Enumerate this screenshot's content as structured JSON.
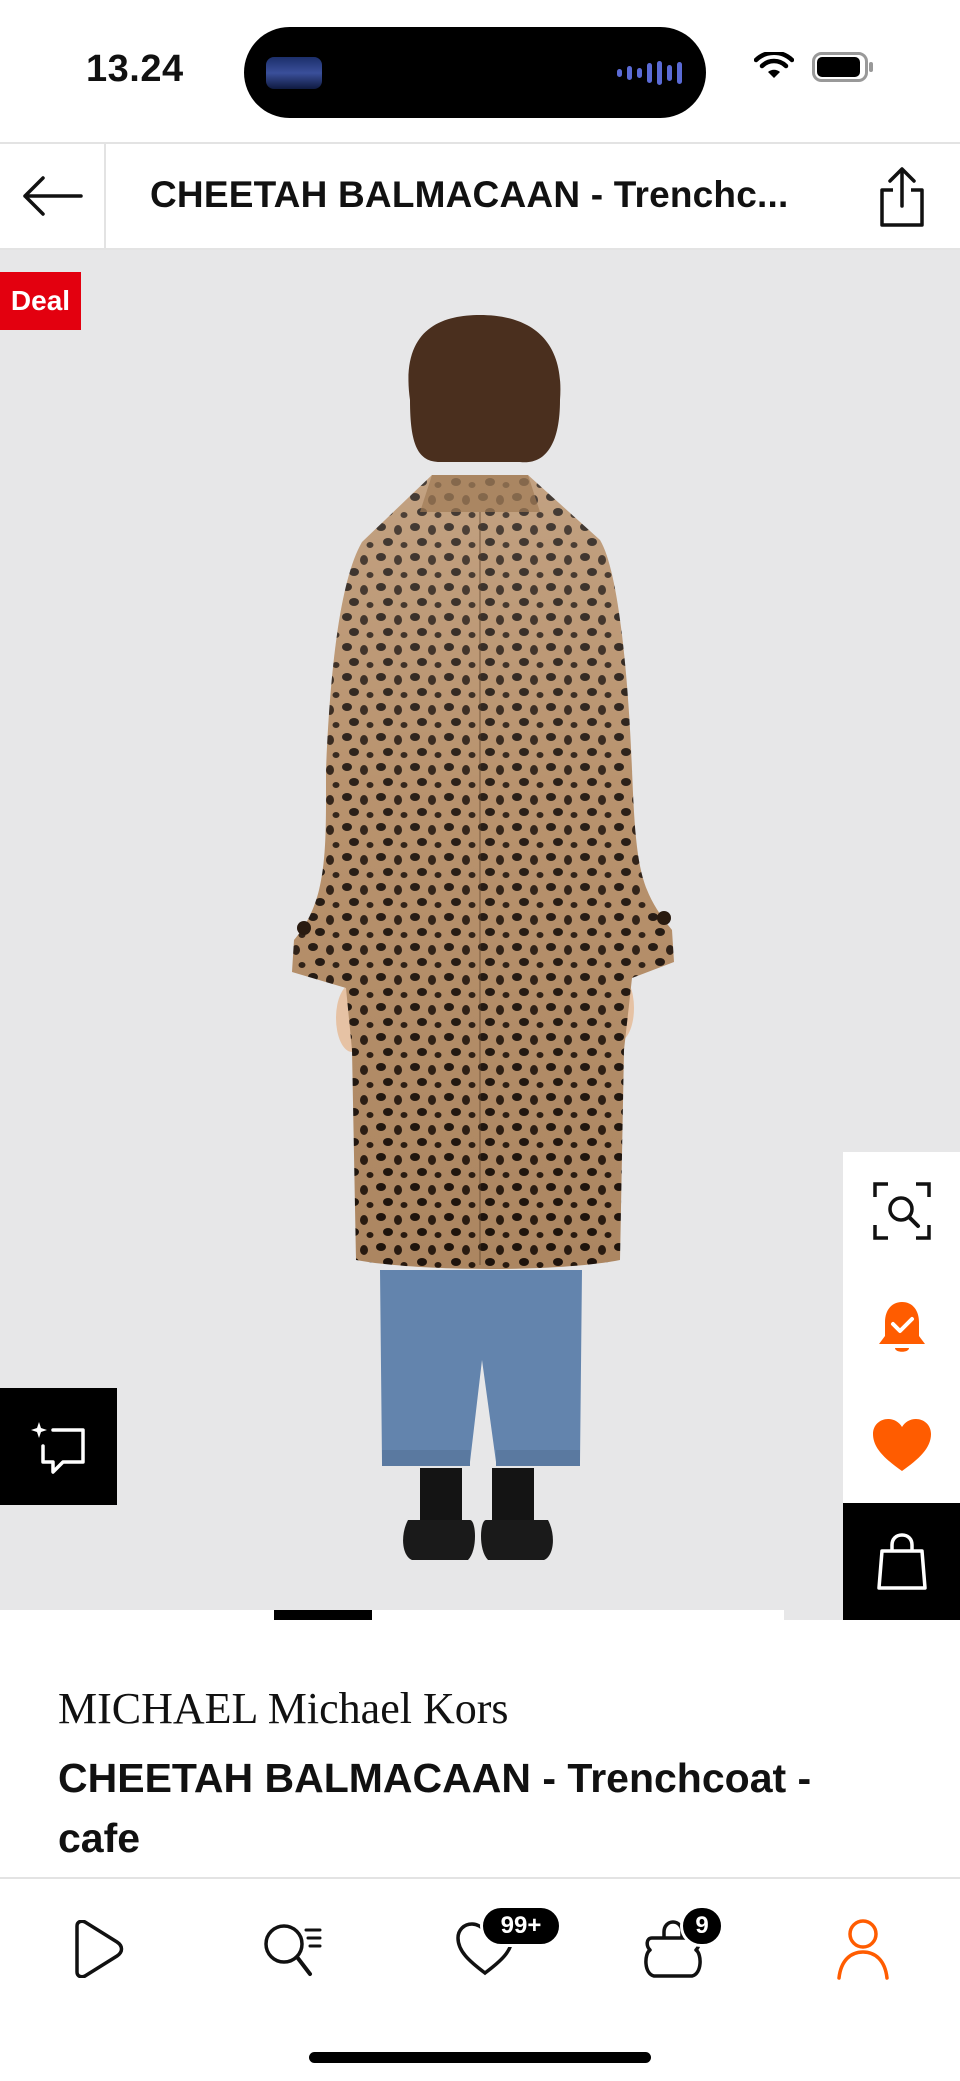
{
  "status_bar": {
    "time": "13.24"
  },
  "header": {
    "title": "CHEETAH BALMACAAN  - Trenchc...",
    "back_icon": "arrow-left-icon",
    "share_icon": "share-icon"
  },
  "gallery": {
    "deal_badge": "Deal",
    "image_description_icon": "product-photo",
    "progress": 0.1,
    "side_actions": [
      "visual-search-icon",
      "price-alert-icon",
      "wishlist-heart-icon",
      "add-to-bag-icon"
    ],
    "compare_icon": "compare-icon"
  },
  "product": {
    "brand": "MICHAEL Michael Kors",
    "name": "CHEETAH BALMACAAN  - Trenchcoat - cafe"
  },
  "bottom_nav": {
    "items": [
      {
        "icon": "home-play-icon"
      },
      {
        "icon": "search-icon"
      },
      {
        "icon": "wishlist-icon",
        "badge": "99+"
      },
      {
        "icon": "bag-icon",
        "badge": "9"
      },
      {
        "icon": "profile-icon"
      }
    ]
  },
  "colors": {
    "accent": "#ff5c00",
    "deal_red": "#e3000f",
    "background_gray": "#e7e7e8",
    "coat_tan": "#b08a64",
    "jeans_blue": "#6384ad"
  }
}
